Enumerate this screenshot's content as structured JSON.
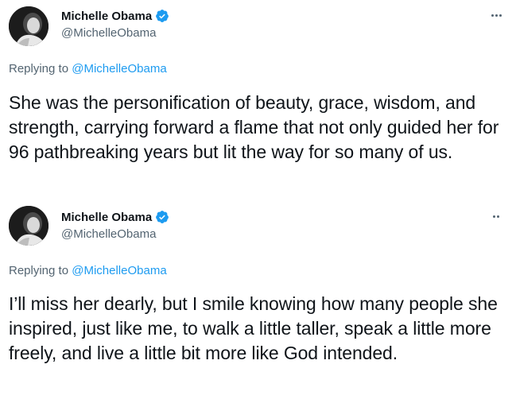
{
  "tweets": [
    {
      "author": {
        "display_name": "Michelle Obama",
        "handle": "@MichelleObama",
        "verified": true
      },
      "replying_prefix": "Replying to ",
      "replying_to": "@MichelleObama",
      "more_icon": "more-horizontal-icon",
      "text": "She was the personification of beauty, grace, wisdom, and strength, carrying forward a flame that not only guided her for 96 pathbreaking years but lit the way for so many of us."
    },
    {
      "author": {
        "display_name": "Michelle Obama",
        "handle": "@MichelleObama",
        "verified": true
      },
      "replying_prefix": "Replying to ",
      "replying_to": "@MichelleObama",
      "more_icon": "more-horizontal-icon",
      "text": "I’ll miss her dearly, but I smile knowing how many people she inspired, just like me, to walk a little taller, speak a little more freely, and live a little bit more like God intended."
    }
  ],
  "colors": {
    "text": "#0f1419",
    "secondary": "#536471",
    "link": "#1d9bf0",
    "verified": "#1d9bf0"
  }
}
